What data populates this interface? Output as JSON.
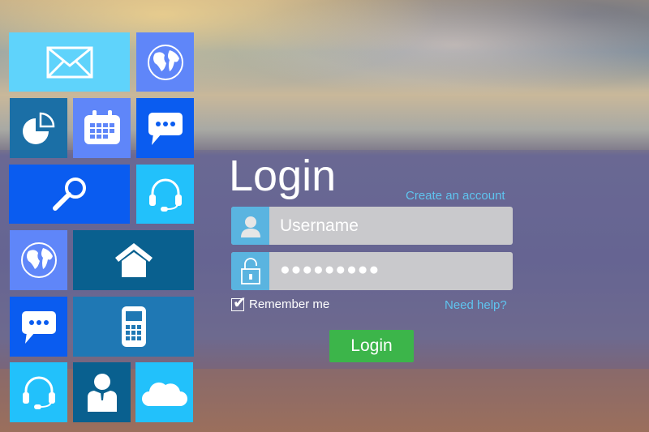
{
  "login": {
    "title": "Login",
    "create_account": "Create an account",
    "username_placeholder": "Username",
    "password_value": "●●●●●●●●●",
    "remember_label": "Remember me",
    "remember_checked": true,
    "need_help": "Need help?",
    "button": "Login"
  },
  "tiles": [
    "mail-icon",
    "globe-icon",
    "pie-chart-icon",
    "calendar-icon",
    "chat-icon",
    "search-icon",
    "headset-icon",
    "globe-icon",
    "home-icon",
    "chat-icon",
    "mobile-phone-icon",
    "headset-icon",
    "user-icon",
    "cloud-icon"
  ],
  "colors": {
    "accent": "#5fc4ef",
    "button": "#3cb54a",
    "field": "#c9c9cc"
  }
}
